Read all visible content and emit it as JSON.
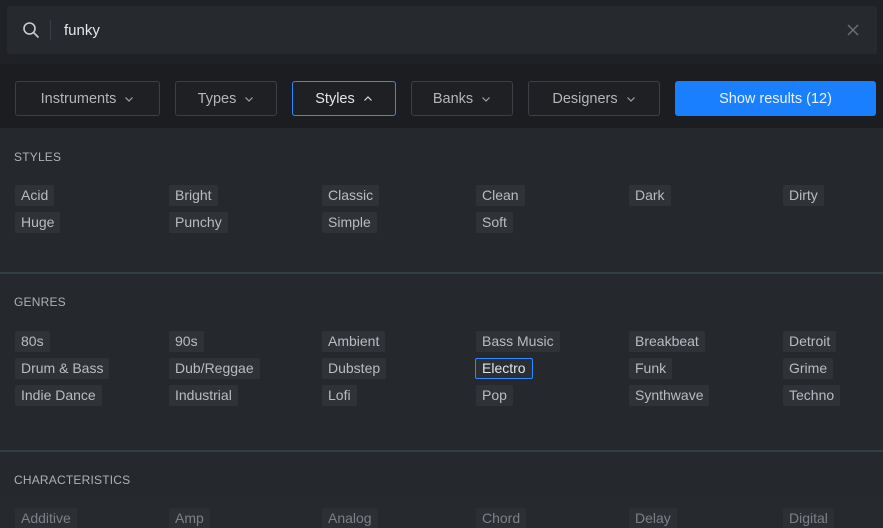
{
  "search": {
    "value": "funky",
    "placeholder": ""
  },
  "filters": [
    {
      "label": "Instruments",
      "state": "collapsed"
    },
    {
      "label": "Types",
      "state": "collapsed"
    },
    {
      "label": "Styles",
      "state": "expanded"
    },
    {
      "label": "Banks",
      "state": "collapsed"
    },
    {
      "label": "Designers",
      "state": "collapsed"
    }
  ],
  "show_results_label": "Show results (12)",
  "sections": {
    "styles": {
      "title": "STYLES",
      "tags": [
        "Acid",
        "Bright",
        "Classic",
        "Clean",
        "Dark",
        "Dirty",
        "Huge",
        "Punchy",
        "Simple",
        "Soft"
      ]
    },
    "genres": {
      "title": "GENRES",
      "selected": "Electro",
      "tags": [
        "80s",
        "90s",
        "Ambient",
        "Bass Music",
        "Breakbeat",
        "Detroit",
        "Drum & Bass",
        "Dub/Reggae",
        "Dubstep",
        "Electro",
        "Funk",
        "Grime",
        "Indie Dance",
        "Industrial",
        "Lofi",
        "Pop",
        "Synthwave",
        "Techno"
      ]
    },
    "characteristics": {
      "title": "CHARACTERISTICS",
      "tags": [
        "Additive",
        "Amp",
        "Analog",
        "Chord",
        "Delay",
        "Digital"
      ]
    }
  },
  "colors": {
    "accent": "#1a7fff",
    "selected_border": "#2d8bff",
    "background": "#25282c"
  }
}
